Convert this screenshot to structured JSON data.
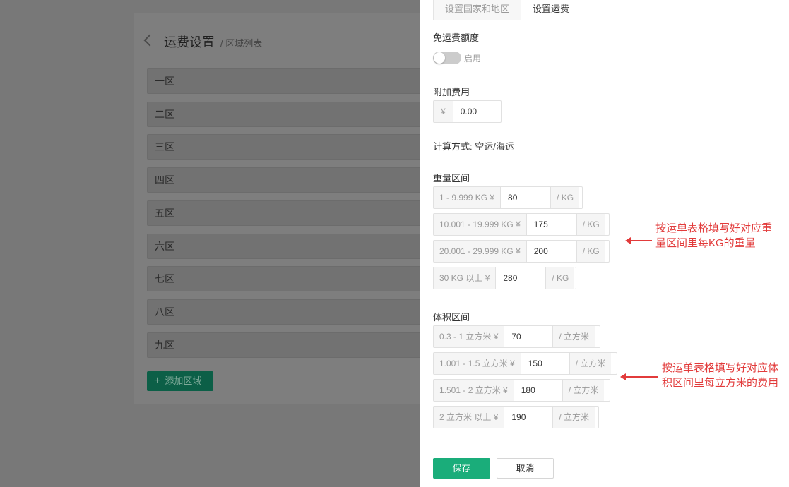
{
  "background": {
    "title": "运费设置",
    "breadcrumb": "/ 区域列表",
    "zones": [
      "一区",
      "二区",
      "三区",
      "四区",
      "五区",
      "六区",
      "七区",
      "八区",
      "九区"
    ],
    "add_zone_label": "添加区域"
  },
  "drawer": {
    "tabs": [
      {
        "label": "设置国家和地区",
        "active": false
      },
      {
        "label": "设置运费",
        "active": true
      }
    ],
    "free_shipping": {
      "label": "免运费额度",
      "toggle_label": "启用",
      "enabled": false
    },
    "extra_fee": {
      "label": "附加费用",
      "currency": "¥",
      "value": "0.00"
    },
    "calc_method": "计算方式: 空运/海运",
    "weight": {
      "label": "重量区间",
      "rows": [
        {
          "range": "1 - 9.999 KG ¥",
          "value": "80",
          "unit": "/ KG"
        },
        {
          "range": "10.001 - 19.999 KG ¥",
          "value": "175",
          "unit": "/ KG"
        },
        {
          "range": "20.001 - 29.999 KG ¥",
          "value": "200",
          "unit": "/ KG"
        },
        {
          "range": "30 KG 以上 ¥",
          "value": "280",
          "unit": "/ KG"
        }
      ]
    },
    "volume": {
      "label": "体积区间",
      "rows": [
        {
          "range": "0.3 - 1 立方米 ¥",
          "value": "70",
          "unit": "/ 立方米"
        },
        {
          "range": "1.001 - 1.5 立方米 ¥",
          "value": "150",
          "unit": "/ 立方米"
        },
        {
          "range": "1.501 - 2 立方米 ¥",
          "value": "180",
          "unit": "/ 立方米"
        },
        {
          "range": "2 立方米 以上 ¥",
          "value": "190",
          "unit": "/ 立方米"
        }
      ]
    },
    "buttons": {
      "save": "保存",
      "cancel": "取消"
    }
  },
  "annotations": {
    "weight_note": [
      "按运单表格填写好对应重",
      "量区间里每KG的重量"
    ],
    "volume_note": [
      "按运单表格填写好对应体",
      "积区间里每立方米的费用"
    ],
    "color": "#e23b3b"
  },
  "colors": {
    "primary": "#1aad7a",
    "overlay_bg": "#787878"
  }
}
